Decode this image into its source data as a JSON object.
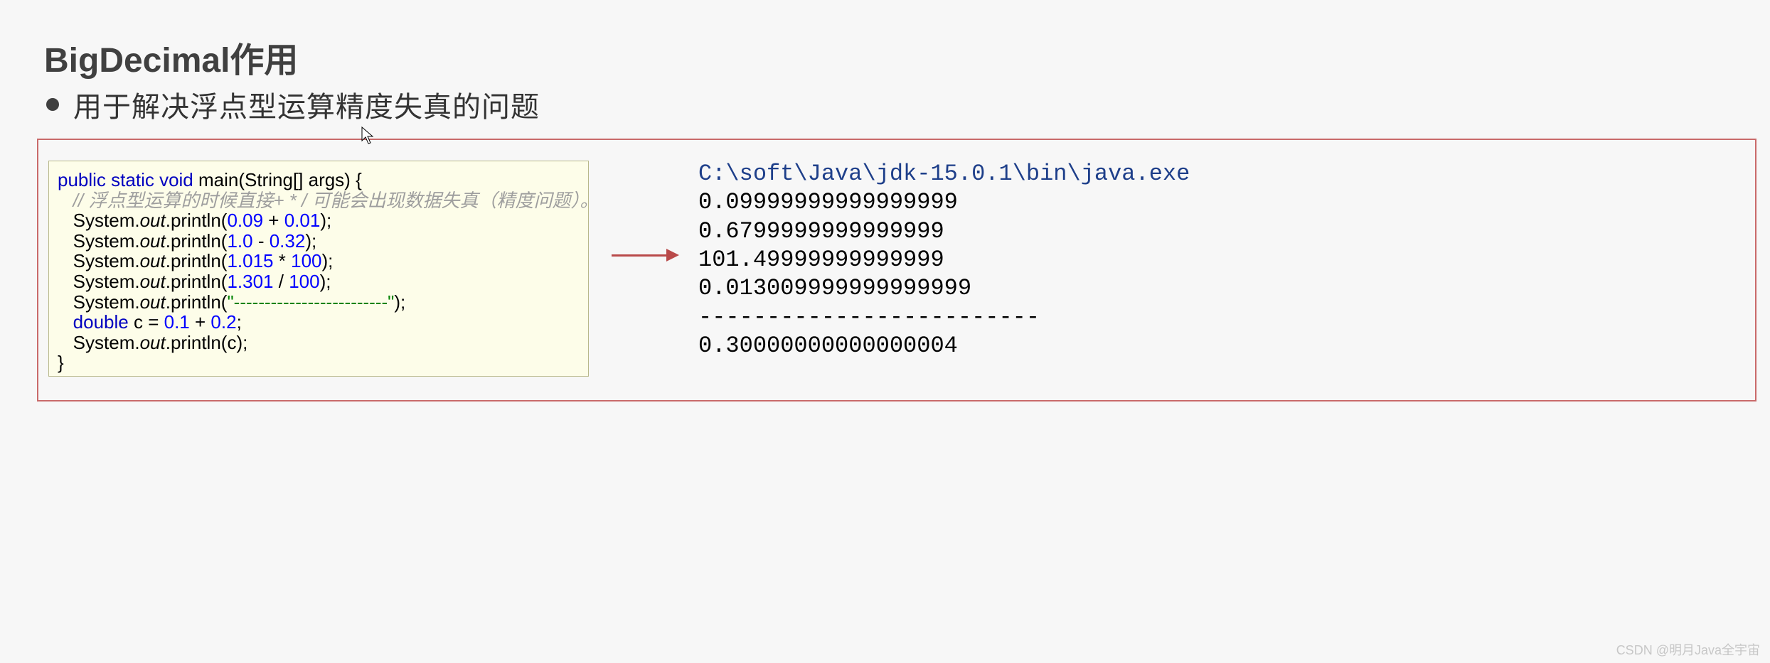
{
  "title": "BigDecimal作用",
  "bullet": "用于解决浮点型运算精度失真的问题",
  "code": {
    "sig": {
      "kw1": "public static void",
      "name": "main",
      "args": "(String[] args) {"
    },
    "comment": "// 浮点型运算的时候直接+ * / 可能会出现数据失真（精度问题）。",
    "l1": {
      "prefix": "System.",
      "out": "out",
      "call1": ".println(",
      "n1": "0.09",
      "op": " + ",
      "n2": "0.01",
      "call2": ");"
    },
    "l2": {
      "prefix": "System.",
      "out": "out",
      "call1": ".println(",
      "n1": "1.0",
      "op": " - ",
      "n2": "0.32",
      "call2": ");"
    },
    "l3": {
      "prefix": "System.",
      "out": "out",
      "call1": ".println(",
      "n1": "1.015",
      "op": " * ",
      "n2": "100",
      "call2": ");"
    },
    "l4": {
      "prefix": "System.",
      "out": "out",
      "call1": ".println(",
      "n1": "1.301",
      "op": " / ",
      "n2": "100",
      "call2": ");"
    },
    "l5": {
      "prefix": "System.",
      "out": "out",
      "call1": ".println(",
      "str": "\"-------------------------\"",
      "call2": ");"
    },
    "l6": {
      "kw": "double",
      "rest1": " c = ",
      "n1": "0.1",
      "op": " + ",
      "n2": "0.2",
      "rest2": ";"
    },
    "l7": {
      "prefix": "System.",
      "out": "out",
      "call": ".println(c);"
    },
    "close": "}"
  },
  "console": {
    "path": "C:\\soft\\Java\\jdk-15.0.1\\bin\\java.exe",
    "o1": "0.09999999999999999",
    "o2": "0.6799999999999999",
    "o3": "101.49999999999999",
    "o4": "0.013009999999999999",
    "o5": "-------------------------",
    "o6": "0.30000000000000004"
  },
  "watermark": "CSDN @明月Java全宇宙"
}
